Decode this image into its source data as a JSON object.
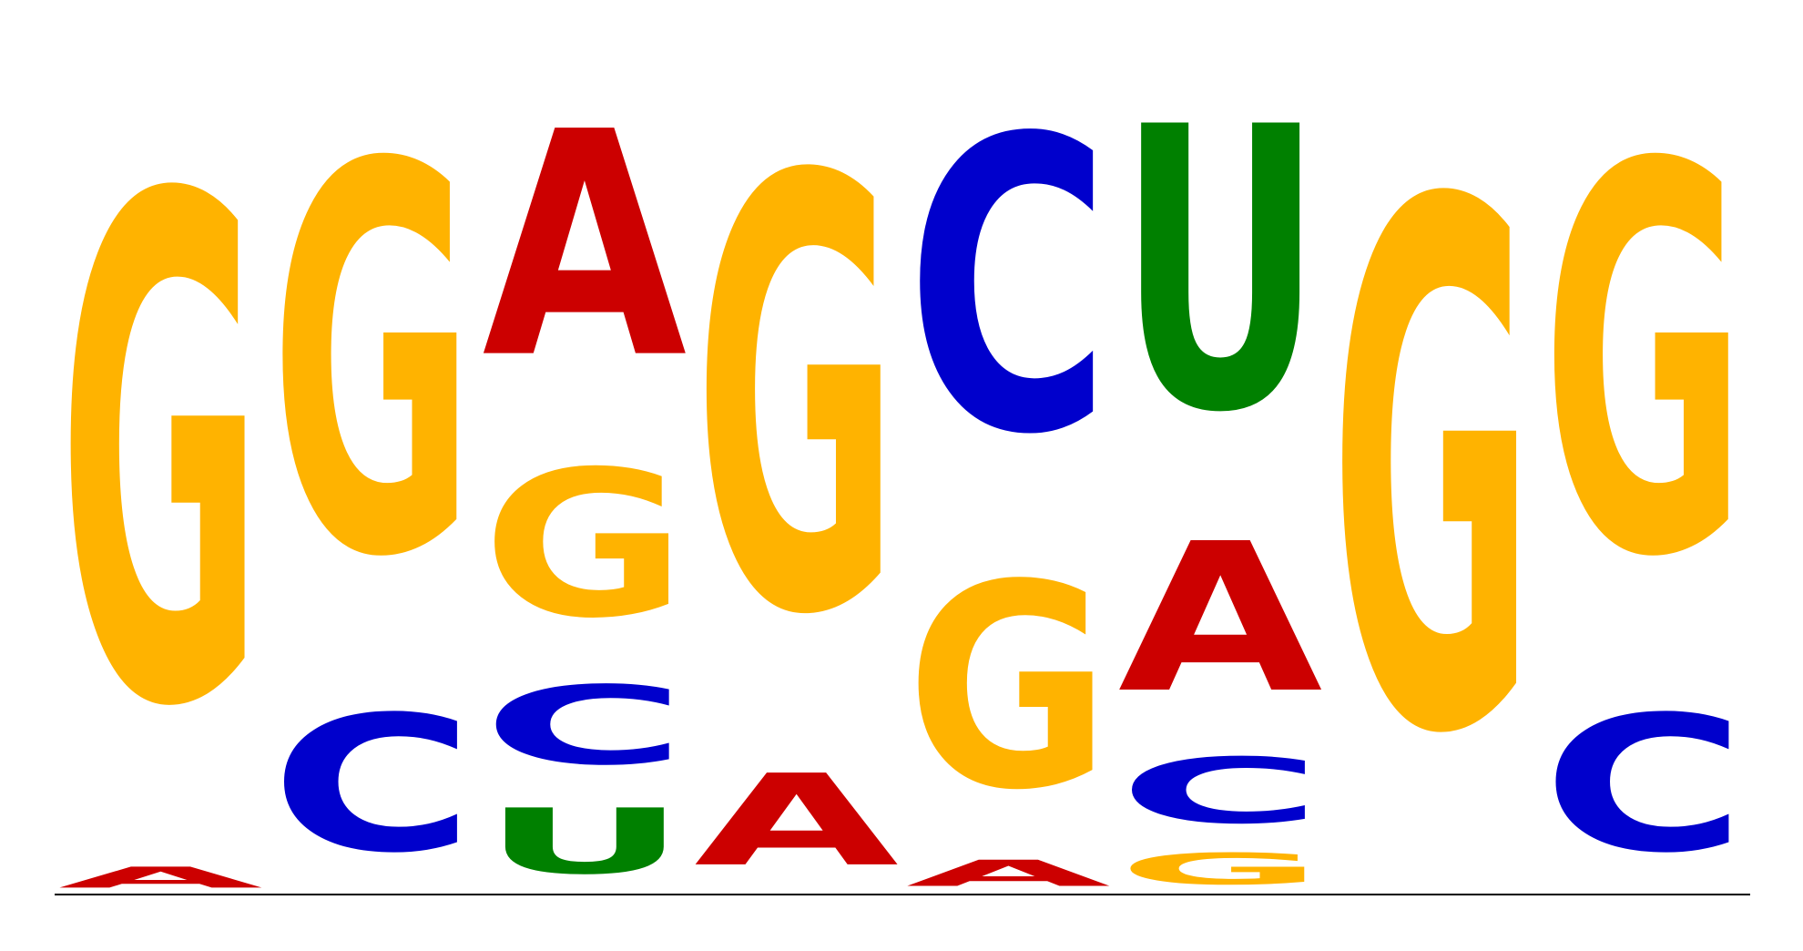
{
  "chart_data": {
    "type": "sequence-logo",
    "alphabet": [
      "A",
      "C",
      "G",
      "U"
    ],
    "colors": {
      "A": "#cc0000",
      "C": "#0000cc",
      "G": "#ffb300",
      "U": "#008000"
    },
    "ylim": [
      0,
      2
    ],
    "positions": [
      {
        "position": 1,
        "stack": [
          {
            "letter": "A",
            "height": 0.08
          },
          {
            "letter": "G",
            "height": 1.92
          }
        ]
      },
      {
        "position": 2,
        "stack": [
          {
            "letter": "C",
            "height": 0.52
          },
          {
            "letter": "G",
            "height": 1.48
          }
        ]
      },
      {
        "position": 3,
        "stack": [
          {
            "letter": "U",
            "height": 0.25
          },
          {
            "letter": "C",
            "height": 0.3
          },
          {
            "letter": "G",
            "height": 0.56
          },
          {
            "letter": "A",
            "height": 0.86
          }
        ]
      },
      {
        "position": 4,
        "stack": [
          {
            "letter": "A",
            "height": 0.35
          },
          {
            "letter": "G",
            "height": 1.65
          }
        ]
      },
      {
        "position": 5,
        "stack": [
          {
            "letter": "A",
            "height": 0.1
          },
          {
            "letter": "G",
            "height": 0.78
          },
          {
            "letter": "C",
            "height": 1.12
          }
        ]
      },
      {
        "position": 6,
        "stack": [
          {
            "letter": "G",
            "height": 0.12
          },
          {
            "letter": "C",
            "height": 0.25
          },
          {
            "letter": "A",
            "height": 0.57
          },
          {
            "letter": "U",
            "height": 1.08
          }
        ]
      },
      {
        "position": 7,
        "stack": [
          {
            "letter": "G",
            "height": 2.0
          }
        ]
      },
      {
        "position": 8,
        "stack": [
          {
            "letter": "C",
            "height": 0.52
          },
          {
            "letter": "G",
            "height": 1.48
          }
        ]
      }
    ]
  }
}
